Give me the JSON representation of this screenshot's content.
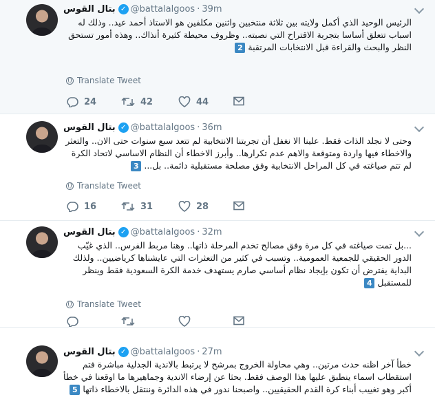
{
  "tweets": [
    {
      "name": "بتال القوس",
      "handle": "@battalalgoos",
      "time": "39m",
      "text": "الرئيس الوحيد الذي أكمل ولايته بين ثلاثة منتخبين واثنين مكلفين هو الاستاذ أحمد عيد.. وذلك له اسباب تتعلق أساسا بتجربة الاقتراح التي نصبته.. وظروف محيطة كثيرة أنذاك.. وهذه أمور تستحق النظر والبحث والقراءة قبل الانتخابات المرتقبة",
      "number": "2",
      "translate": "Translate Tweet",
      "replies": "24",
      "retweets": "42",
      "likes": "44"
    },
    {
      "name": "بتال القوس",
      "handle": "@battalalgoos",
      "time": "36m",
      "text": "وحتى لا نجلد الذات فقط. علينا الا نغفل أن تجربتنا الانتخابية لم تتعد سبع سنوات حتى الان.. والتعثر والاخطاء فيها واردة ومتوقعة والاهم عدم تكرارها.. وأبرز الاخطاء أن النظام الاساسي لاتحاد الكرة لم تتم صياغته في كل المراحل الانتخابية وفق مصلحة مستقبلية دائمة.. بل...",
      "number": "3",
      "translate": "Translate Tweet",
      "replies": "16",
      "retweets": "31",
      "likes": "28"
    },
    {
      "name": "بتال القوس",
      "handle": "@battalalgoos",
      "time": "32m",
      "text": "...بل تمت صياغته في كل مرة وفق مصالح تخدم المرحلة ذاتها.. وهنا مربط الفرس.. الذي غيّب الدور الحقيقي للجمعية العمومية.. وتسبب في كثير من التعثرات التي عايشناها كرياضيين.. ولذلك البداية يفترض أن تكون بإيجاد نظام أساسي صارم يستهدف خدمة الكرة السعودية فقط وينظر للمستقبل",
      "number": "4",
      "translate": "Translate Tweet",
      "replies": "",
      "retweets": "",
      "likes": ""
    },
    {
      "name": "بتال القوس",
      "handle": "@battalalgoos",
      "time": "27m",
      "text": "خطأ آخر اظنه حدث مرتين.. وهي محاولة الخروج بمرشح لا يرتبط بالاندية الجدلية مباشرة فتم استقطاب اسماء ينطبق عليها هذا الوصف فقط. بحثا عن إرضاء الاندية وجماهيرها ما اوقعنا في خطأ أكبر وهو تغييب أبناء كرة القدم الحقيقيين.. واصبحنا ندور في هذه الدائرة وننتقل بالاخطاء ذاتها",
      "number": "5"
    }
  ],
  "icons": {
    "reply": "reply-icon",
    "retweet": "retweet-icon",
    "like": "heart-icon",
    "dm": "envelope-icon",
    "translate": "globe-icon",
    "verified": "verified-badge-icon",
    "caret": "chevron-down-icon"
  },
  "colors": {
    "text": "#14171a",
    "secondary": "#657786",
    "verified": "#1da1f2",
    "highlight_bg": "#f5f8fa",
    "keycap": "#3b88c3"
  }
}
